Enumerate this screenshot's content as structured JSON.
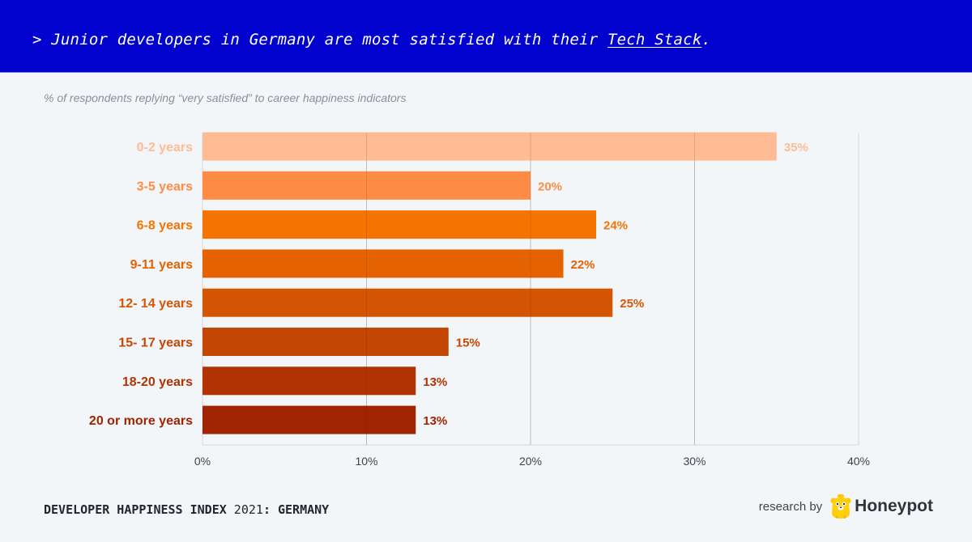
{
  "header": {
    "prefix": "> Junior developers in Germany are most satisfied with their ",
    "emphasis": "Tech Stack",
    "suffix": "."
  },
  "subtitle": "% of respondents replying “very satisfied” to career happiness indicators",
  "footer": {
    "title_bold_1": "DEVELOPER HAPPINESS INDEX",
    "title_year": " 2021",
    "title_bold_2": ": GERMANY",
    "research_by": "research by",
    "brand_name": "Honeypot",
    "brand_icon": "honeypot-bear-logo"
  },
  "chart_data": {
    "type": "bar",
    "orientation": "horizontal",
    "title": "Junior developers in Germany are most satisfied with their Tech Stack.",
    "subtitle": "% of respondents replying “very satisfied” to career happiness indicators",
    "xlabel": "",
    "ylabel": "",
    "categories": [
      "0-2 years",
      "3-5 years",
      "6-8 years",
      "9-11 years",
      "12- 14 years",
      "15- 17 years",
      "18-20 years",
      "20 or more years"
    ],
    "values": [
      35,
      20,
      24,
      22,
      25,
      15,
      13,
      13
    ],
    "value_labels": [
      "35%",
      "20%",
      "24%",
      "22%",
      "25%",
      "15%",
      "13%",
      "13%"
    ],
    "colors": [
      "#ffbb93",
      "#ff8c45",
      "#f57300",
      "#e46300",
      "#d45503",
      "#c44603",
      "#b13303",
      "#a12402"
    ],
    "xlim": [
      0,
      40
    ],
    "xticks": [
      0,
      10,
      20,
      30,
      40
    ],
    "xtick_labels": [
      "0%",
      "10%",
      "20%",
      "30%",
      "40%"
    ],
    "grid": true,
    "legend": "none"
  }
}
